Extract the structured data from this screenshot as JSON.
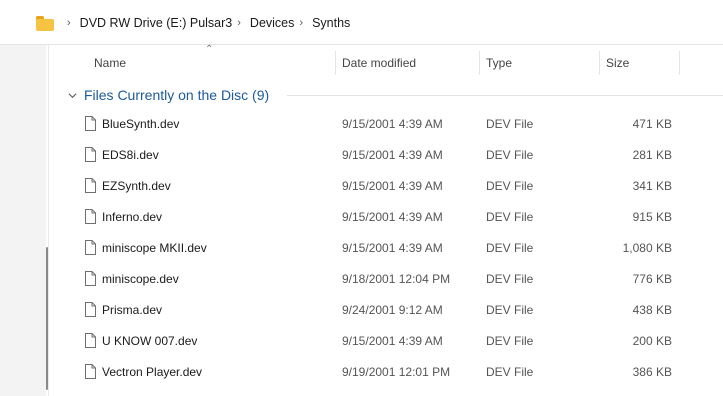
{
  "breadcrumb": {
    "items": [
      "DVD RW Drive (E:) Pulsar3",
      "Devices",
      "Synths"
    ]
  },
  "columns": {
    "name": "Name",
    "date_modified": "Date modified",
    "type": "Type",
    "size": "Size"
  },
  "group": {
    "label": "Files Currently on the Disc (9)"
  },
  "files": [
    {
      "name": "BlueSynth.dev",
      "date": "9/15/2001 4:39 AM",
      "type": "DEV File",
      "size": "471 KB"
    },
    {
      "name": "EDS8i.dev",
      "date": "9/15/2001 4:39 AM",
      "type": "DEV File",
      "size": "281 KB"
    },
    {
      "name": "EZSynth.dev",
      "date": "9/15/2001 4:39 AM",
      "type": "DEV File",
      "size": "341 KB"
    },
    {
      "name": "Inferno.dev",
      "date": "9/15/2001 4:39 AM",
      "type": "DEV File",
      "size": "915 KB"
    },
    {
      "name": "miniscope MKII.dev",
      "date": "9/15/2001 4:39 AM",
      "type": "DEV File",
      "size": "1,080 KB"
    },
    {
      "name": "miniscope.dev",
      "date": "9/18/2001 12:04 PM",
      "type": "DEV File",
      "size": "776 KB"
    },
    {
      "name": "Prisma.dev",
      "date": "9/24/2001 9:12 AM",
      "type": "DEV File",
      "size": "438 KB"
    },
    {
      "name": "U KNOW 007.dev",
      "date": "9/15/2001 4:39 AM",
      "type": "DEV File",
      "size": "200 KB"
    },
    {
      "name": "Vectron Player.dev",
      "date": "9/19/2001 12:01 PM",
      "type": "DEV File",
      "size": "386 KB"
    }
  ],
  "colors": {
    "group_label": "#1c5a9c",
    "folder": "#f6c343"
  },
  "icons": {
    "location": "folder-icon",
    "separator": "chevron-right-icon",
    "group_toggle": "chevron-down-icon",
    "sort": "sort-ascending-icon",
    "file": "file-icon"
  }
}
